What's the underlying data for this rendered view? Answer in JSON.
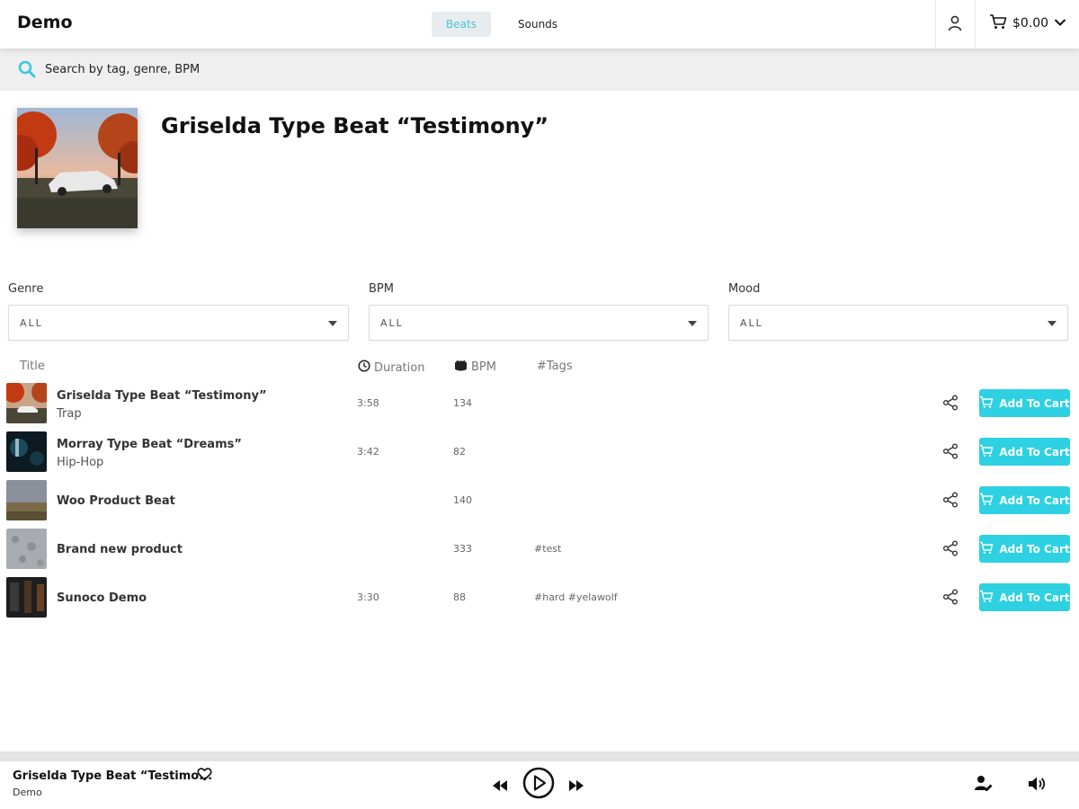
{
  "header": {
    "brand": "Demo",
    "tabs": [
      {
        "label": "Beats",
        "active": true
      },
      {
        "label": "Sounds",
        "active": false
      }
    ],
    "user_icon": "user-icon",
    "cart_total": "$0.00"
  },
  "search": {
    "placeholder": "Search by tag, genre, BPM"
  },
  "hero": {
    "title": "Griselda Type Beat “Testimony”"
  },
  "filters": [
    {
      "label": "Genre",
      "value": "ALL"
    },
    {
      "label": "BPM",
      "value": "ALL"
    },
    {
      "label": "Mood",
      "value": "ALL"
    }
  ],
  "table": {
    "headers": {
      "title": "Title",
      "duration": "Duration",
      "bpm": "BPM",
      "tags": "#Tags"
    },
    "rows": [
      {
        "title": "Griselda Type Beat “Testimony”",
        "genre": "Trap",
        "duration": "3:58",
        "bpm": "134",
        "tags": "",
        "action": "Add To Cart"
      },
      {
        "title": "Morray Type Beat “Dreams”",
        "genre": "Hip-Hop",
        "duration": "3:42",
        "bpm": "82",
        "tags": "",
        "action": "Add To Cart"
      },
      {
        "title": "Woo Product Beat",
        "genre": "",
        "duration": "",
        "bpm": "140",
        "tags": "",
        "action": "Add To Cart"
      },
      {
        "title": "Brand new product",
        "genre": "",
        "duration": "",
        "bpm": "333",
        "tags": "#test",
        "action": "Add To Cart"
      },
      {
        "title": "Sunoco Demo",
        "genre": "",
        "duration": "3:30",
        "bpm": "88",
        "tags": "#hard #yelawolf",
        "action": "Add To Cart"
      }
    ]
  },
  "player": {
    "title": "Griselda Type Beat “Testimo...",
    "artist": "Demo"
  },
  "colors": {
    "accent": "#2dd1e2",
    "tab_active_text": "#4fc3d8",
    "search_bg": "#efefef"
  }
}
